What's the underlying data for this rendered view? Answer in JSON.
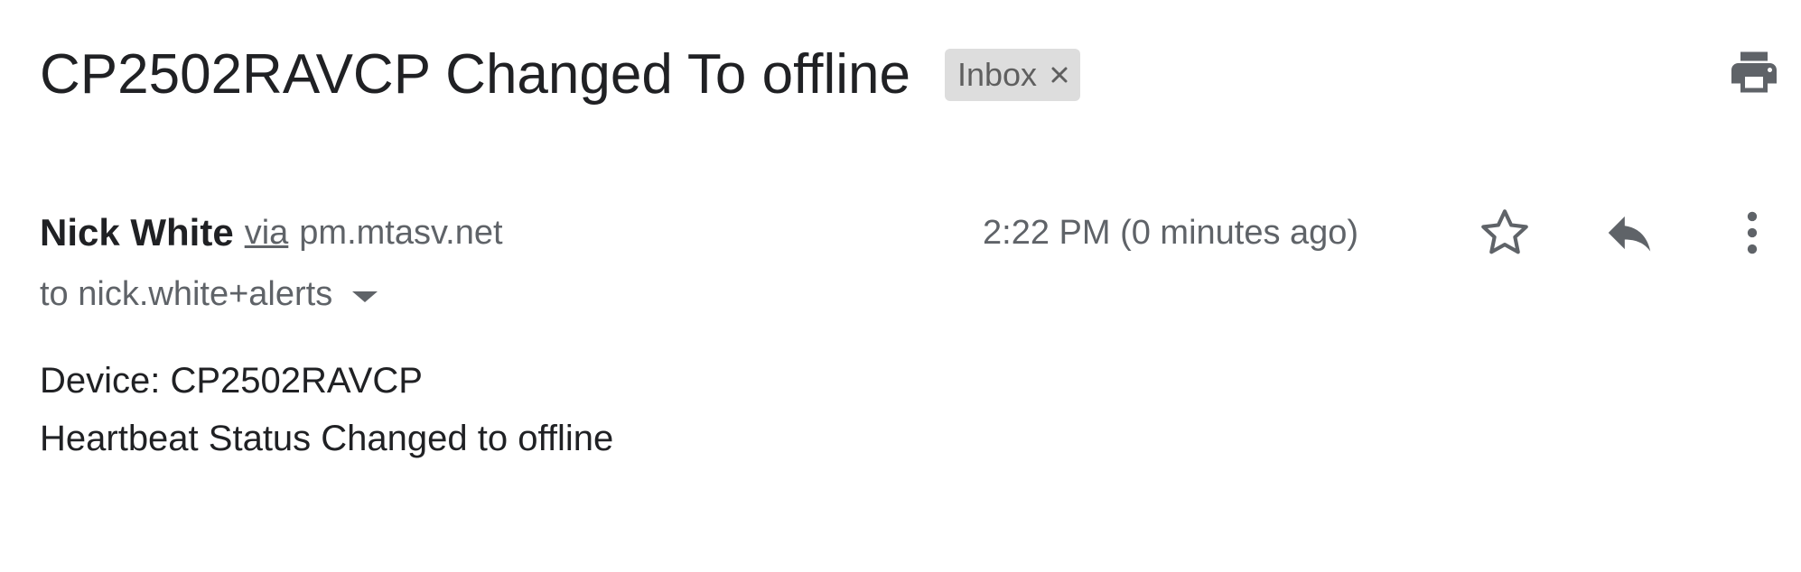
{
  "email": {
    "subject": "CP2502RAVCP Changed To offline",
    "label": "Inbox",
    "sender": {
      "name": "Nick White",
      "via": "via",
      "domain": "pm.mtasv.net"
    },
    "timestamp": "2:22 PM (0 minutes ago)",
    "recipient": "to nick.white+alerts",
    "body": {
      "line1": "Device: CP2502RAVCP",
      "line2": "Heartbeat Status Changed to offline"
    }
  },
  "icons": {
    "print": "print-icon",
    "star": "star-icon",
    "reply": "reply-icon",
    "more": "more-vert-icon",
    "label_close": "close-icon",
    "recipient_expand": "caret-down-icon"
  },
  "colors": {
    "text_primary": "#202124",
    "text_secondary": "#5f6368",
    "chip_background": "#dddddd",
    "icon": "#5f6368"
  }
}
